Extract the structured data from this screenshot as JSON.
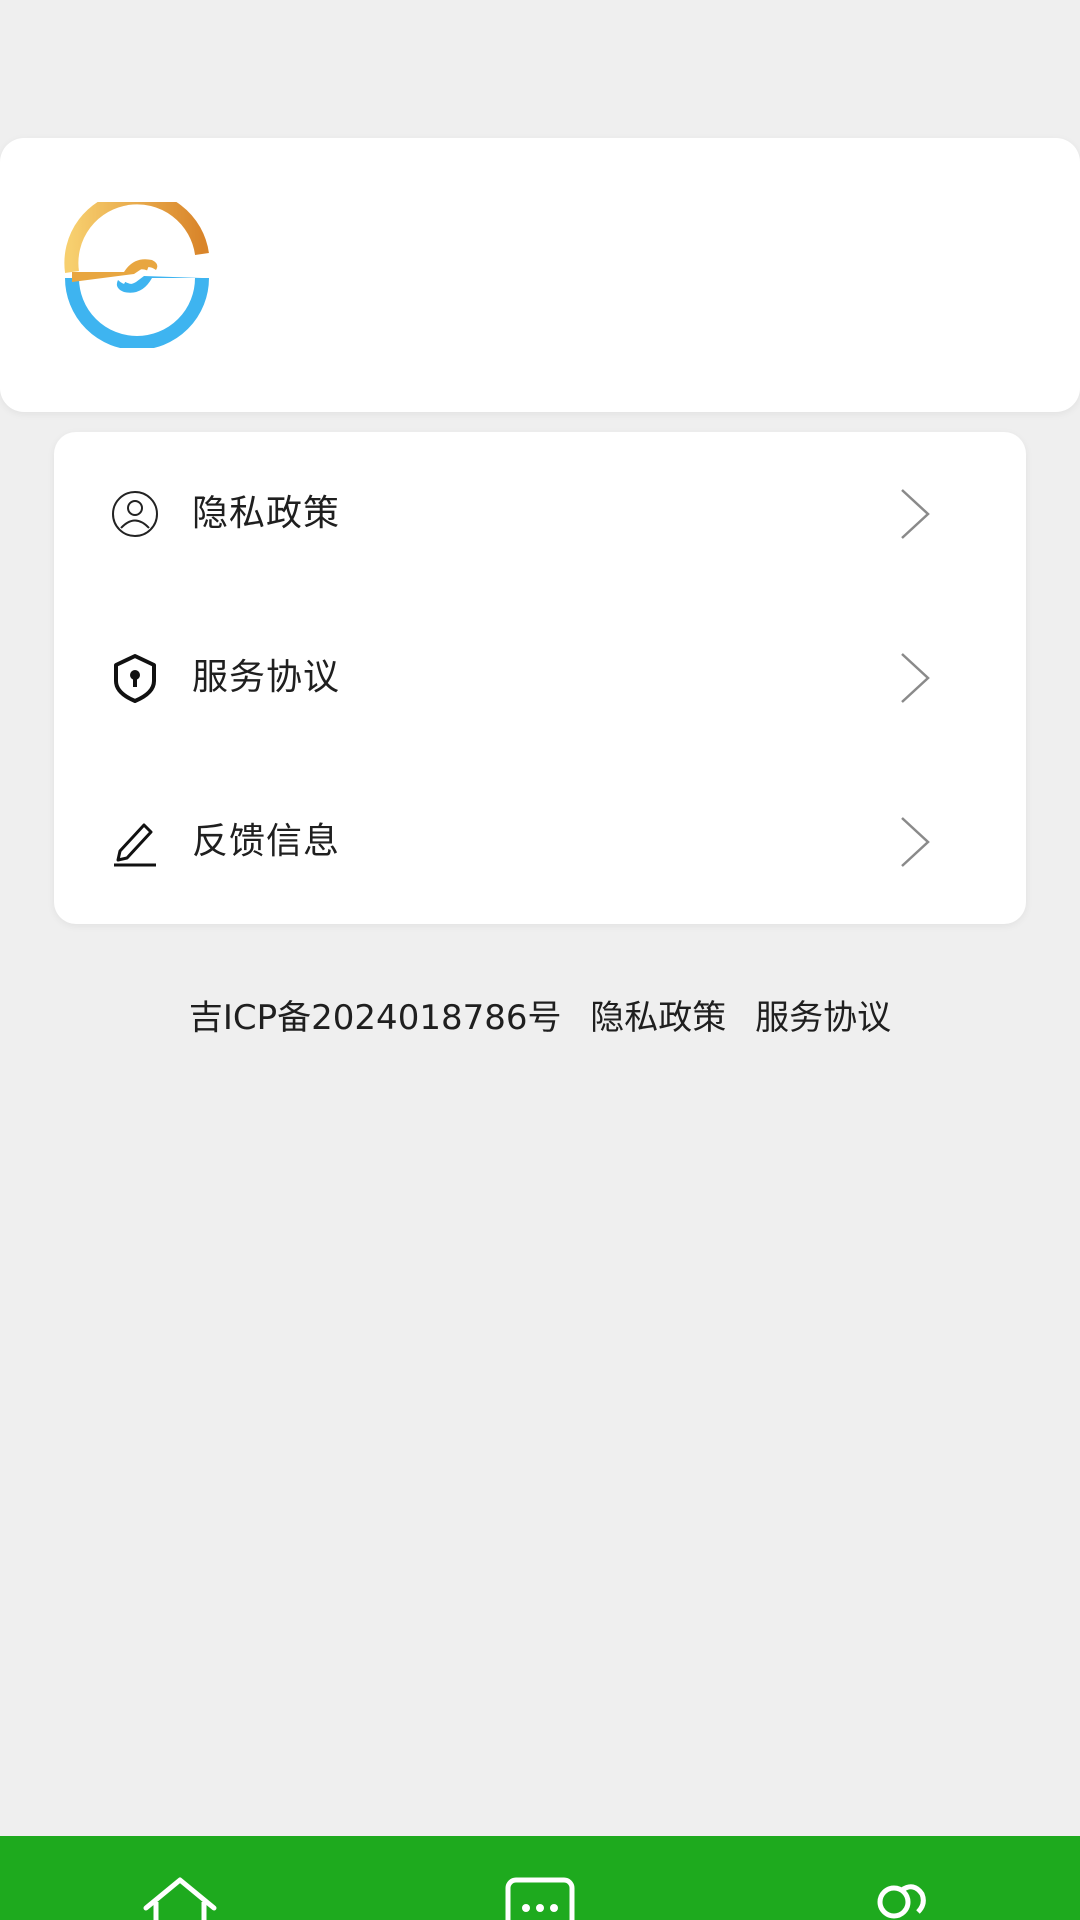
{
  "menu": {
    "items": [
      {
        "label": "隐私政策",
        "icon": "user-circle-icon"
      },
      {
        "label": "服务协议",
        "icon": "shield-lock-icon"
      },
      {
        "label": "反馈信息",
        "icon": "pencil-icon"
      }
    ]
  },
  "footer": {
    "icp": "吉ICP备2024018786号",
    "privacy_link": "隐私政策",
    "service_link": "服务协议"
  },
  "bottom_nav": {
    "items": [
      {
        "icon": "home-icon"
      },
      {
        "icon": "message-icon"
      },
      {
        "icon": "users-icon"
      }
    ],
    "background": "#1eaa1e"
  },
  "colors": {
    "page_bg": "#efefef",
    "card_bg": "#ffffff",
    "logo_gold": "#e8a640",
    "logo_blue": "#3eb4f0"
  }
}
